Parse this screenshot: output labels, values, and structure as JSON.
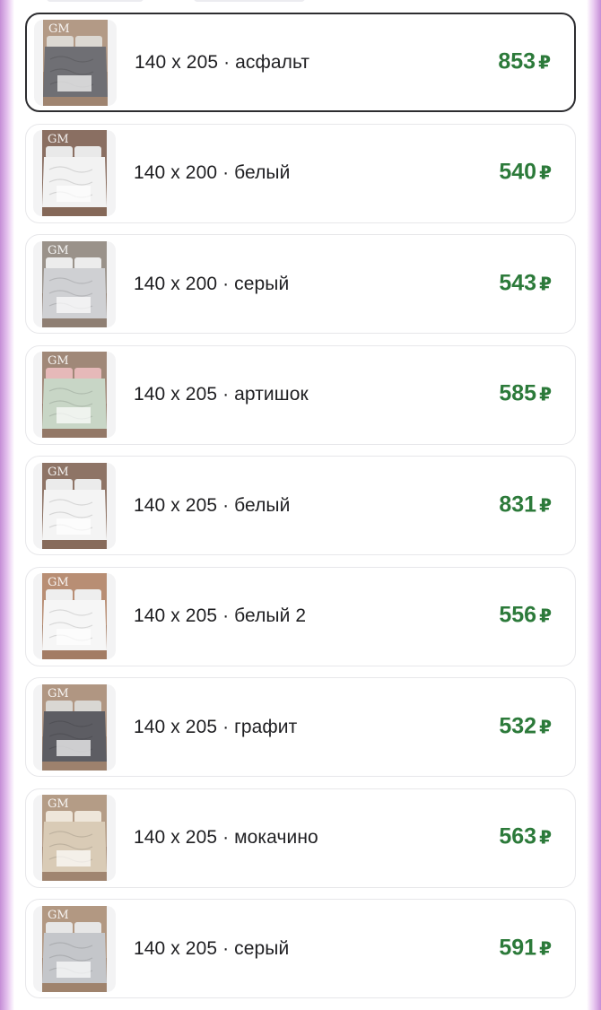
{
  "variants": [
    {
      "label": "140 x 205 · асфальт",
      "price": "853",
      "currency": "₽",
      "selected": true,
      "image_icon": "blanket-photo-icon",
      "colors": {
        "wall": "#b39a86",
        "blanket": "#6f6f74",
        "pillow": "#dcd8d2"
      }
    },
    {
      "label": "140 x 200 · белый",
      "price": "540",
      "currency": "₽",
      "selected": false,
      "image_icon": "blanket-photo-icon",
      "colors": {
        "wall": "#8a6f62",
        "blanket": "#f2f2f2",
        "pillow": "#e9e9e9"
      }
    },
    {
      "label": "140 x 200 · серый",
      "price": "543",
      "currency": "₽",
      "selected": false,
      "image_icon": "blanket-photo-icon",
      "colors": {
        "wall": "#9a928a",
        "blanket": "#cfd0d3",
        "pillow": "#ececec"
      }
    },
    {
      "label": "140 x 205 · артишок",
      "price": "585",
      "currency": "₽",
      "selected": false,
      "image_icon": "blanket-photo-icon",
      "colors": {
        "wall": "#a08878",
        "blanket": "#c8d6c6",
        "pillow": "#e6b9b9"
      }
    },
    {
      "label": "140 x 205 · белый",
      "price": "831",
      "currency": "₽",
      "selected": false,
      "image_icon": "blanket-photo-icon",
      "colors": {
        "wall": "#8e7466",
        "blanket": "#f4f4f4",
        "pillow": "#ebebeb"
      }
    },
    {
      "label": "140 x 205 · белый 2",
      "price": "556",
      "currency": "₽",
      "selected": false,
      "image_icon": "blanket-photo-icon",
      "colors": {
        "wall": "#b88e74",
        "blanket": "#f6f6f6",
        "pillow": "#eeeeee"
      }
    },
    {
      "label": "140 x 205 · графит",
      "price": "532",
      "currency": "₽",
      "selected": false,
      "image_icon": "blanket-photo-icon",
      "colors": {
        "wall": "#b09682",
        "blanket": "#5d5d63",
        "pillow": "#d9d7d3"
      }
    },
    {
      "label": "140 x 205 · мокачино",
      "price": "563",
      "currency": "₽",
      "selected": false,
      "image_icon": "blanket-photo-icon",
      "colors": {
        "wall": "#b49c86",
        "blanket": "#d9cbb6",
        "pillow": "#eee6da"
      }
    },
    {
      "label": "140 x 205 · серый",
      "price": "591",
      "currency": "₽",
      "selected": false,
      "image_icon": "blanket-photo-icon",
      "colors": {
        "wall": "#b29882",
        "blanket": "#c4c6ca",
        "pillow": "#e6e6e6"
      }
    }
  ]
}
